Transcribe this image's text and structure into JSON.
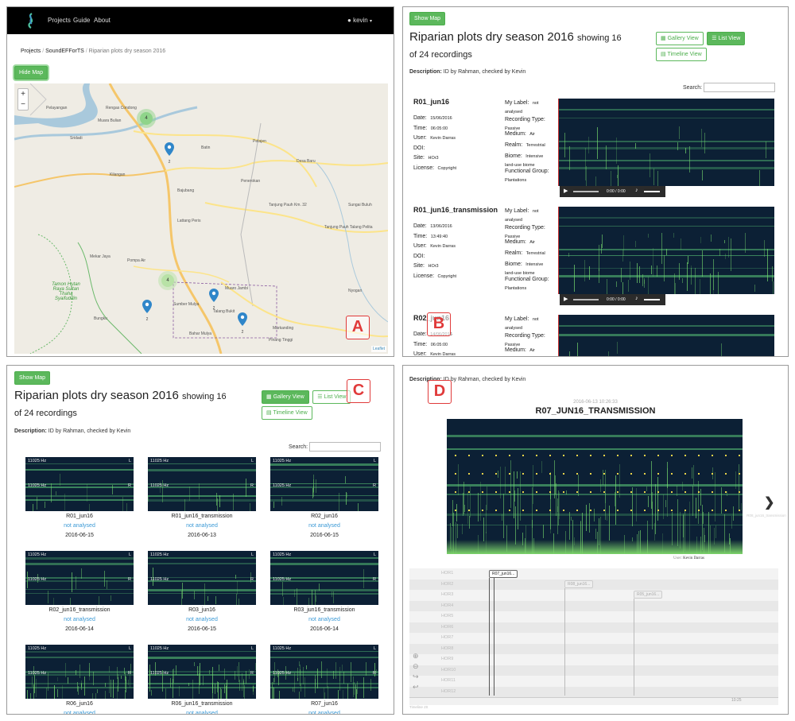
{
  "tags": {
    "a": "A",
    "b": "B",
    "c": "C",
    "d": "D"
  },
  "navbar": {
    "projects": "Projects",
    "guide": "Guide",
    "about": "About",
    "user": "kevin"
  },
  "breadcrumb": {
    "root": "Projects",
    "project": "SoundEFForTS",
    "current": "Riparian plots dry season 2016"
  },
  "map": {
    "hide_label": "Hide Map",
    "zoom_in": "+",
    "zoom_out": "−",
    "attribution": "Leaflet",
    "cluster_a": "4",
    "cluster_b": "4",
    "places": [
      "Pelayangan",
      "Muara Bulian",
      "Sridadi",
      "Rengas Condong",
      "Petajen",
      "Desa Baru",
      "Bajubang",
      "Penerokan",
      "Lattang Peris",
      "Kilangan",
      "Pompa Air",
      "Mekar Jaya",
      "Tamon Hutan Raya Sultan Thaha Syaifuddin",
      "Sumber Mulya",
      "Muaro Jambi",
      "Talang Bukit",
      "Tanjung Pauh Km. 32",
      "Tanjung Pauh Talang Pelita",
      "Markanding",
      "Pinang Tinggi",
      "Nyogan",
      "Bungku",
      "Bahar Mulya",
      "Sungai Buluh",
      "Batin"
    ],
    "pin_counts": [
      "2",
      "2",
      "2",
      "2",
      "2"
    ]
  },
  "header": {
    "show_map": "Show Map",
    "title": "Riparian plots dry season 2016",
    "showing": "showing 16",
    "of": "of 24 recordings",
    "description_label": "Description:",
    "description": "ID by Rahman, checked by Kevin",
    "search_label": "Search:"
  },
  "views": {
    "gallery": "Gallery View",
    "list": "List View",
    "timeline": "Timeline View"
  },
  "list_labels": {
    "date": "Date:",
    "time": "Time:",
    "user": "User:",
    "doi": "DOI:",
    "site": "Site:",
    "license": "License:",
    "my_label": "My Label:",
    "rec_type": "Recording Type:",
    "medium": "Medium:",
    "realm": "Realm:",
    "biome": "Biome:",
    "functional": "Functional Group:"
  },
  "recordings": [
    {
      "name": "R01_jun16",
      "date": "15/06/2016",
      "time": "06:05:00",
      "user": "Kevin Darras",
      "site": "HOr3",
      "license": "Copyright",
      "my_label": "not analysed",
      "rec_type": "Passive",
      "medium": "Air",
      "realm": "Terrestrial",
      "biome": "Intensive land-use biome",
      "functional": "Plantations",
      "player": "0:00 / 0:00"
    },
    {
      "name": "R01_jun16_transmission",
      "date": "13/06/2016",
      "time": "13:49:40",
      "user": "Kevin Darras",
      "site": "HOr3",
      "license": "Copyright",
      "my_label": "not analysed",
      "rec_type": "Passive",
      "medium": "Air",
      "realm": "Terrestrial",
      "biome": "Intensive land-use biome",
      "functional": "Plantations",
      "player": "0:00 / 0:00"
    },
    {
      "name": "R02_jun16",
      "date": "14/06/2016",
      "time": "06:05:00",
      "user": "Kevin Darras",
      "my_label": "not analysed",
      "rec_type": "Passive",
      "medium": "Air"
    }
  ],
  "gallery": {
    "hz": "11025 Hz",
    "L": "L",
    "R": "R",
    "items": [
      {
        "name": "R01_jun16",
        "status": "not analysed",
        "date": "2016-06-15"
      },
      {
        "name": "R01_jun16_transmission",
        "status": "not analysed",
        "date": "2016-06-13"
      },
      {
        "name": "R02_jun16",
        "status": "not analysed",
        "date": "2016-06-15"
      },
      {
        "name": "R02_jun16_transmission",
        "status": "not analysed",
        "date": "2016-06-14"
      },
      {
        "name": "R03_jun16",
        "status": "not analysed",
        "date": "2016-06-15"
      },
      {
        "name": "R03_jun16_transmission",
        "status": "not analysed",
        "date": "2016-06-14"
      },
      {
        "name": "R06_jun16",
        "status": "not analysed",
        "date": ""
      },
      {
        "name": "R06_jun16_transmission",
        "status": "not analysed",
        "date": ""
      },
      {
        "name": "R07_jun16",
        "status": "not analysed",
        "date": ""
      }
    ]
  },
  "timeline": {
    "timestamp": "2016-06-13 10:26:33",
    "title": "R07_JUN16_TRANSMISSION",
    "credit_label": "User:",
    "credit": "Kevin Darras",
    "next_label": "R08_jun16_transmission",
    "rows": [
      "HOR1",
      "HOR2",
      "HOR3",
      "HOR4",
      "HOR5",
      "HOR6",
      "HOR7",
      "HOR8",
      "HOR9",
      "HOR10",
      "HOR11",
      "HOR12"
    ],
    "events": [
      "R07_jun16...",
      "R08_jun16...",
      "R05_jun16..."
    ],
    "tick": "10:25",
    "footer": "Timeline JS"
  }
}
